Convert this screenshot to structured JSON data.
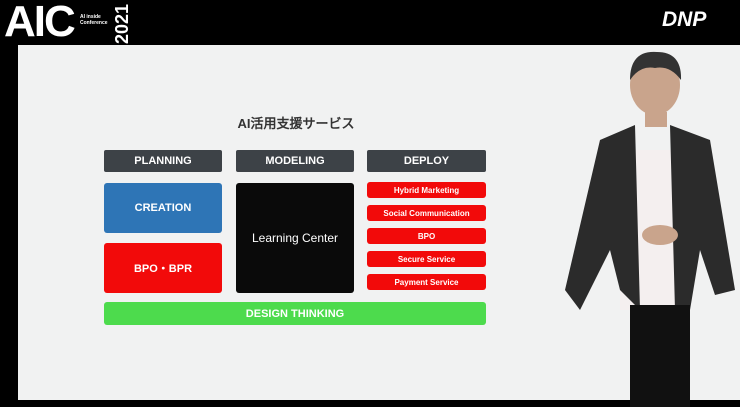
{
  "event_logo": {
    "letters": "AIC",
    "subtitle1": "AI inside",
    "subtitle2": "Conference",
    "year": "2021"
  },
  "brand": "DNP",
  "slide": {
    "title": "AI活用支援サービス",
    "columns": [
      "PLANNING",
      "MODELING",
      "DEPLOY"
    ],
    "planning": [
      "CREATION",
      "BPO・BPR"
    ],
    "modeling": "Learning Center",
    "deploy": [
      "Hybrid Marketing",
      "Social Communication",
      "BPO",
      "Secure Service",
      "Payment Service"
    ],
    "footer": "DESIGN THINKING"
  },
  "colors": {
    "header": "#3d4247",
    "creation": "#2e75b6",
    "red": "#f20a0a",
    "green": "#4ddb4d",
    "learning": "#0a0a0a"
  }
}
